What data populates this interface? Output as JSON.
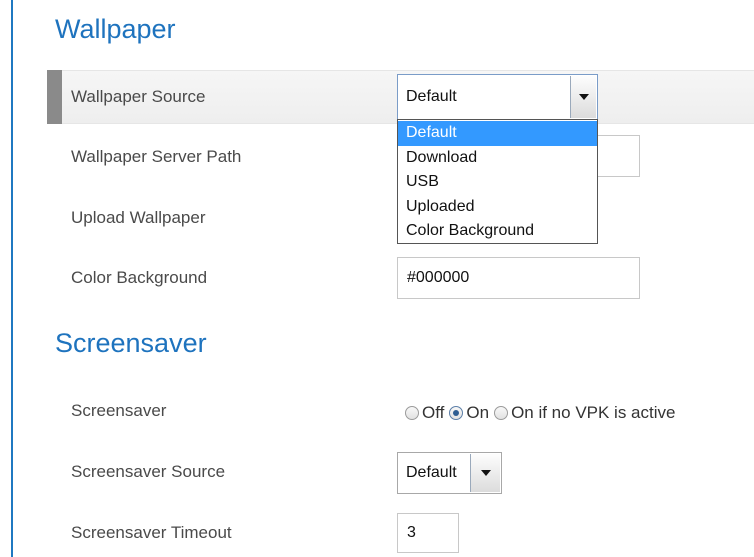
{
  "wallpaper": {
    "title": "Wallpaper",
    "source_label": "Wallpaper Source",
    "source_value": "Default",
    "source_options": [
      "Default",
      "Download",
      "USB",
      "Uploaded",
      "Color Background"
    ],
    "server_path_label": "Wallpaper Server Path",
    "upload_label": "Upload Wallpaper",
    "color_bg_label": "Color Background",
    "color_bg_value": "#000000"
  },
  "screensaver": {
    "title": "Screensaver",
    "mode_label": "Screensaver",
    "mode_options": [
      "Off",
      "On",
      "On if no VPK is active"
    ],
    "mode_selected": "On",
    "source_label": "Screensaver Source",
    "source_value": "Default",
    "timeout_label": "Screensaver Timeout",
    "timeout_value": "3"
  },
  "colors": {
    "heading": "#1e73be",
    "selected_option": "#3399ff"
  }
}
